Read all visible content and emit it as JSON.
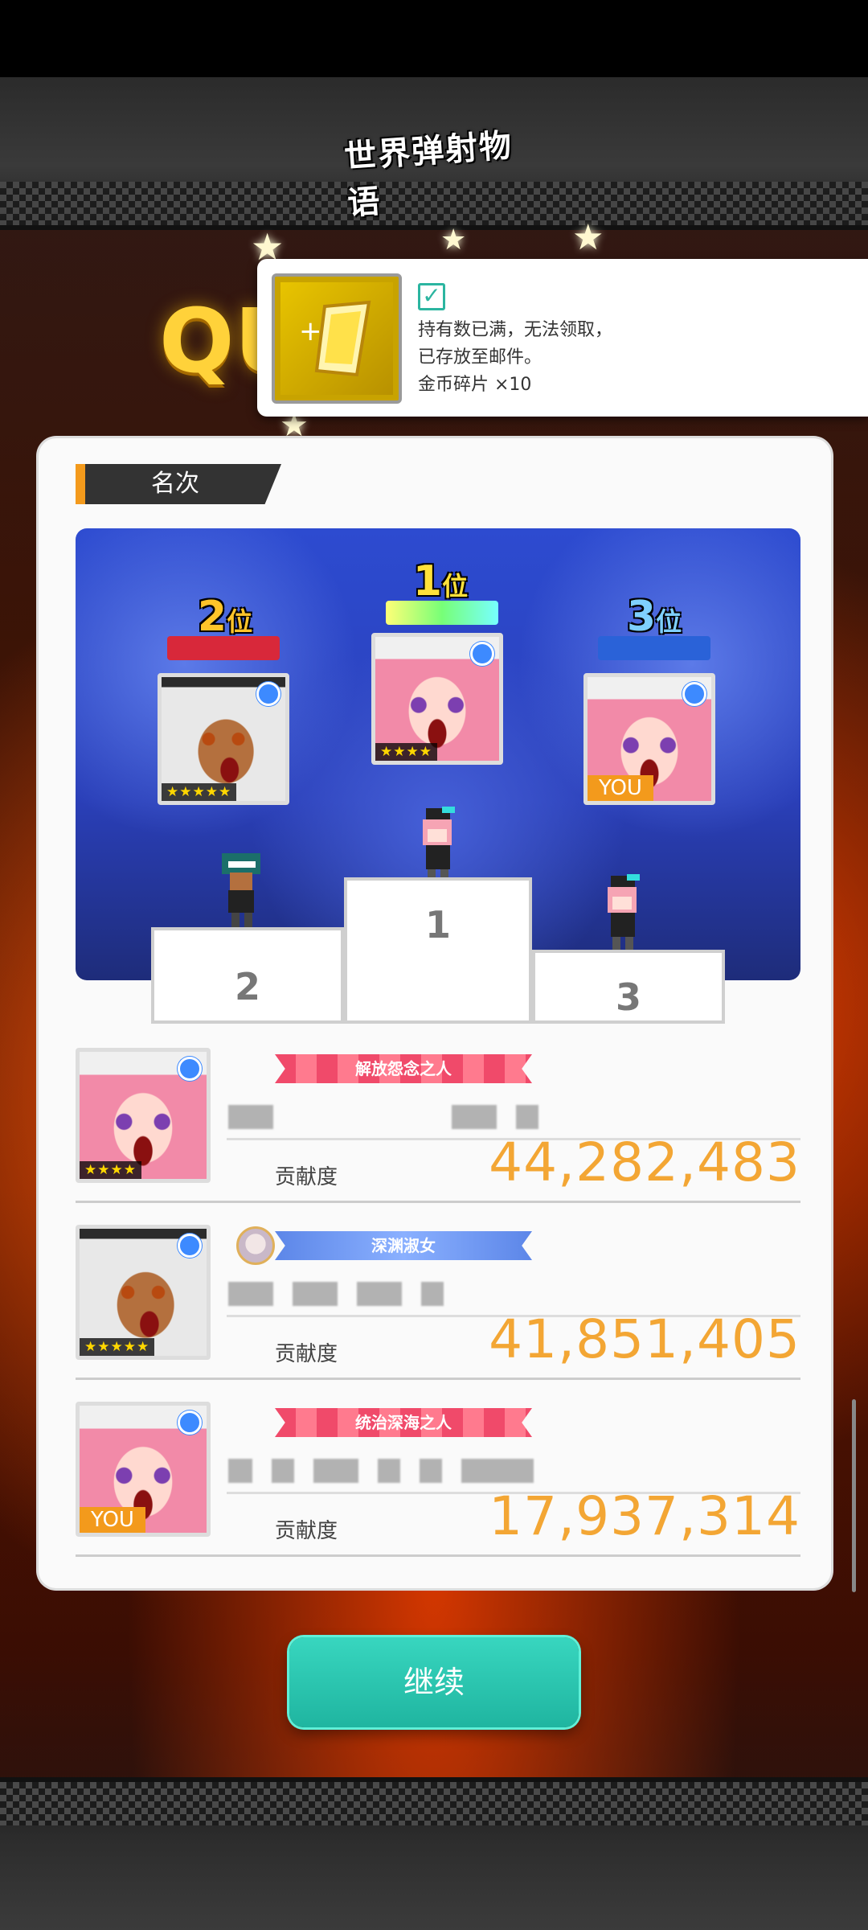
{
  "app": {
    "logo_text": "世界弹射物语",
    "banner_partial": "QU"
  },
  "notification": {
    "item_icon": "gold-coin-fragment-icon",
    "check_icon": "checkbox-icon",
    "line1": "持有数已满，无法领取，",
    "line2": "已存放至邮件。",
    "line3": "金币碎片 ×10"
  },
  "ranking": {
    "tab_label": "名次",
    "podium": [
      {
        "place": "1",
        "ribbon_label": "1",
        "ribbon_suffix": "位",
        "stars": "★★★★",
        "badge": ""
      },
      {
        "place": "2",
        "ribbon_label": "2",
        "ribbon_suffix": "位",
        "stars": "★★★★★",
        "badge": ""
      },
      {
        "place": "3",
        "ribbon_label": "3",
        "ribbon_suffix": "位",
        "stars": "",
        "badge": "YOU"
      }
    ],
    "blocks": [
      "1",
      "2",
      "3"
    ]
  },
  "list": [
    {
      "title": "解放怨念之人",
      "contribution_label": "贡献度",
      "contribution_value": "44,282,483",
      "stars": "★★★★",
      "badge": ""
    },
    {
      "title": "深渊淑女",
      "contribution_label": "贡献度",
      "contribution_value": "41,851,405",
      "stars": "★★★★★",
      "badge": ""
    },
    {
      "title": "统治深海之人",
      "contribution_label": "贡献度",
      "contribution_value": "17,937,314",
      "stars": "",
      "badge": "YOU"
    }
  ],
  "continue_label": "继续",
  "colors": {
    "accent_orange": "#f3a634",
    "continue_teal": "#2bc6b0",
    "check_teal": "#2bb5a0",
    "marker_blue": "#3d8aff"
  }
}
